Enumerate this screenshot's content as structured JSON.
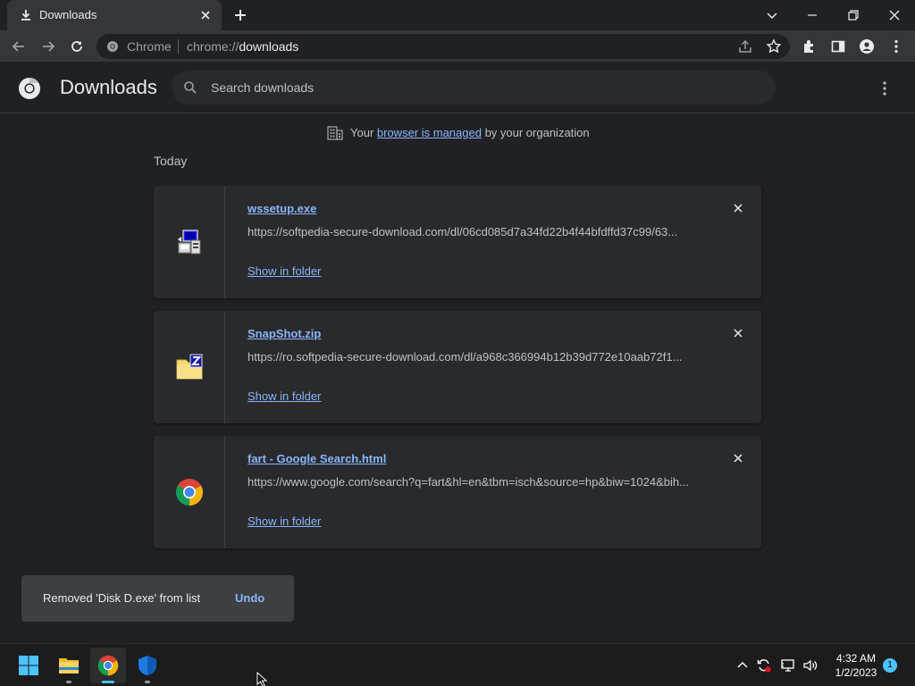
{
  "browser": {
    "tab_title": "Downloads",
    "omnibox_site": "Chrome",
    "omnibox_url_scheme": "chrome://",
    "omnibox_url_path": "downloads"
  },
  "header": {
    "title": "Downloads",
    "search_placeholder": "Search downloads"
  },
  "managed": {
    "prefix": "Your ",
    "link": "browser is managed",
    "suffix": " by your organization"
  },
  "section_label": "Today",
  "downloads": [
    {
      "name": "wssetup.exe",
      "url": "https://softpedia-secure-download.com/dl/06cd085d7a34fd22b4f44bfdffd37c99/63...",
      "action": "Show in folder",
      "icon": "installer-icon"
    },
    {
      "name": "SnapShot.zip",
      "url": "https://ro.softpedia-secure-download.com/dl/a968c366994b12b39d772e10aab72f1...",
      "action": "Show in folder",
      "icon": "zip-folder-icon"
    },
    {
      "name": "fart - Google Search.html",
      "url": "https://www.google.com/search?q=fart&hl=en&tbm=isch&source=hp&biw=1024&bih...",
      "action": "Show in folder",
      "icon": "chrome-icon"
    }
  ],
  "toast": {
    "message": "Removed 'Disk D.exe' from list",
    "undo": "Undo"
  },
  "taskbar": {
    "time": "4:32 AM",
    "date": "1/2/2023",
    "notification_count": "1"
  },
  "colors": {
    "link": "#8ab4f8",
    "background": "#202124",
    "card": "#292a2d"
  }
}
